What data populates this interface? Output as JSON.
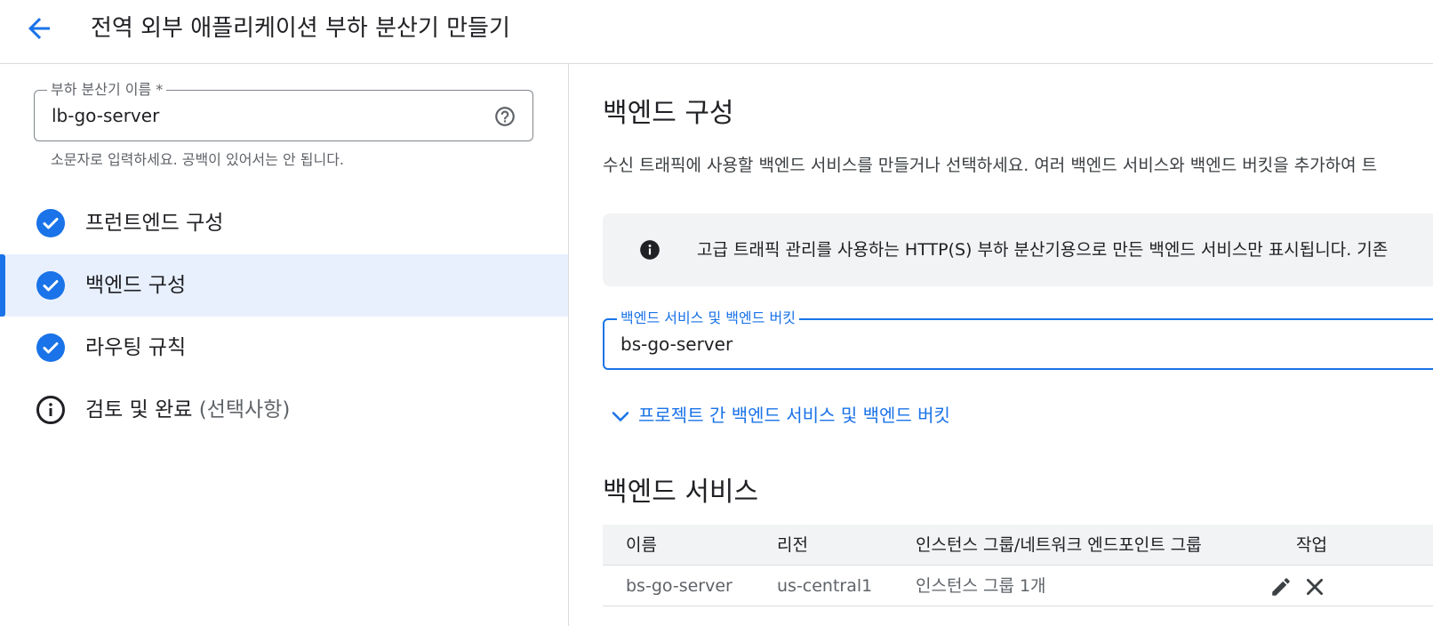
{
  "header": {
    "back_icon": "arrow-back-icon",
    "title": "전역 외부 애플리케이션 부하 분산기 만들기"
  },
  "left_panel": {
    "name_field": {
      "label": "부하 분산기 이름 *",
      "value": "lb-go-server",
      "help_icon": "help-circle-icon",
      "hint": "소문자로 입력하세요. 공백이 있어서는 안 됩니다."
    },
    "steps": [
      {
        "label": "프런트엔드 구성",
        "icon": "check-circle-icon",
        "active": false
      },
      {
        "label": "백엔드 구성",
        "icon": "check-circle-icon",
        "active": true
      },
      {
        "label": "라우팅 규칙",
        "icon": "check-circle-icon",
        "active": false
      },
      {
        "label": "검토 및 완료",
        "suffix": "(선택사항)",
        "icon": "info-outline-icon",
        "active": false
      }
    ]
  },
  "right_panel": {
    "title": "백엔드 구성",
    "description": "수신 트래픽에 사용할 백엔드 서비스를 만들거나 선택하세요. 여러 백엔드 서비스와 백엔드 버킷을 추가하여 트",
    "info_banner": {
      "icon": "info-filled-icon",
      "text": "고급 트래픽 관리를 사용하는 HTTP(S) 부하 분산기용으로 만든 백엔드 서비스만 표시됩니다. 기존"
    },
    "backend_field": {
      "label": "백엔드 서비스 및 백엔드 버킷",
      "value": "bs-go-server"
    },
    "cross_project_link": {
      "icon": "chevron-down-icon",
      "label": "프로젝트 간 백엔드 서비스 및 백엔드 버킷"
    },
    "services": {
      "title": "백엔드 서비스",
      "columns": [
        "이름",
        "리전",
        "인스턴스 그룹/네트워크 엔드포인트 그룹",
        "작업"
      ],
      "rows": [
        {
          "name": "bs-go-server",
          "region": "us-central1",
          "group": "인스턴스 그룹 1개",
          "actions": [
            "edit-icon",
            "close-icon"
          ]
        }
      ]
    }
  },
  "colors": {
    "accent": "#1a73e8",
    "active_bg": "#e8f0fe",
    "banner_bg": "#f1f3f4",
    "text_primary": "#202124",
    "text_secondary": "#5f6368",
    "divider": "#dadce0"
  }
}
